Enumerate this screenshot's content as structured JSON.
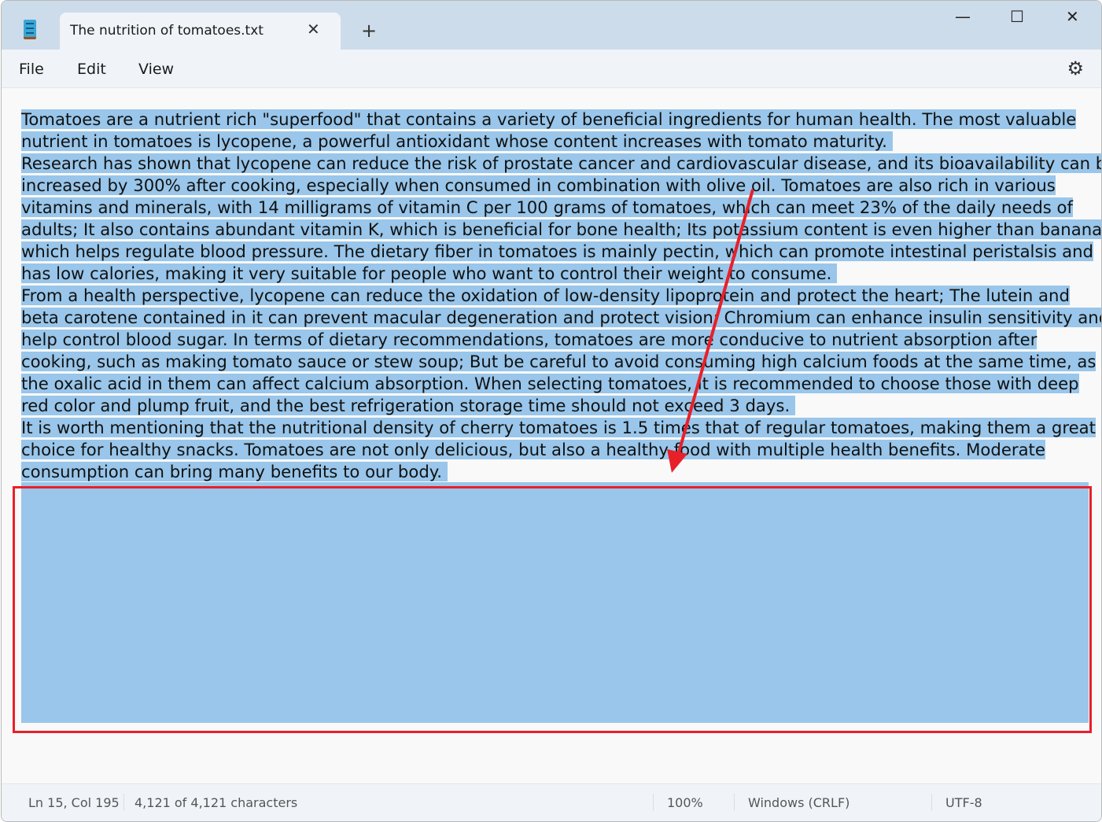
{
  "window": {
    "tab_title": "The nutrition of tomatoes.txt",
    "new_tab": "+",
    "close_tab": "✕",
    "minimize": "—",
    "maximize": "☐",
    "close": "✕"
  },
  "menu": {
    "file": "File",
    "edit": "Edit",
    "view": "View",
    "settings": "⚙"
  },
  "editor": {
    "lines": [
      "Tomatoes are a nutrient rich \"superfood\" that contains a variety of beneficial ingredients for human health. The most valuable",
      "nutrient in tomatoes is lycopene, a powerful antioxidant whose content increases with tomato maturity. ",
      "Research has shown that lycopene can reduce the risk of prostate cancer and cardiovascular disease, and its bioavailability can be",
      "increased by 300% after cooking, especially when consumed in combination with olive oil. Tomatoes are also rich in various",
      "vitamins and minerals, with 14 milligrams of vitamin C per 100 grams of tomatoes, which can meet 23% of the daily needs of",
      "adults; It also contains abundant vitamin K, which is beneficial for bone health; Its potassium content is even higher than bananas,",
      "which helps regulate blood pressure. The dietary fiber in tomatoes is mainly pectin, which can promote intestinal peristalsis and",
      "has low calories, making it very suitable for people who want to control their weight to consume. ",
      "From a health perspective, lycopene can reduce the oxidation of low-density lipoprotein and protect the heart; The lutein and",
      "beta carotene contained in it can prevent macular degeneration and protect vision; Chromium can enhance insulin sensitivity and",
      "help control blood sugar. In terms of dietary recommendations, tomatoes are more conducive to nutrient absorption after",
      "cooking, such as making tomato sauce or stew soup; But be careful to avoid consuming high calcium foods at the same time, as",
      "the oxalic acid in them can affect calcium absorption. When selecting tomatoes, it is recommended to choose those with deep",
      "red color and plump fruit, and the best refrigeration storage time should not exceed 3 days. ",
      "It is worth mentioning that the nutritional density of cherry tomatoes is 1.5 times that of regular tomatoes, making them a great",
      "choice for healthy snacks. Tomatoes are not only delicious, but also a healthy food with multiple health benefits. Moderate",
      "consumption can bring many benefits to our body. "
    ]
  },
  "status": {
    "position": "Ln 15, Col 195",
    "characters": "4,121 of 4,121 characters",
    "zoom": "100%",
    "line_ending": "Windows (CRLF)",
    "encoding": "UTF-8"
  },
  "colors": {
    "selection": "#99c6ea",
    "annotation": "#e8202a"
  }
}
